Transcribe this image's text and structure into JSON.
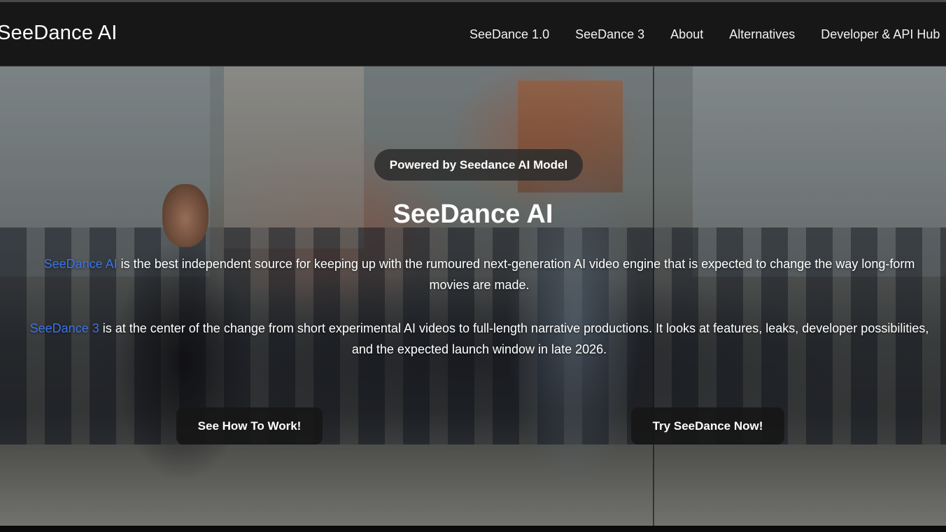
{
  "brand": {
    "name": "SeeDance AI"
  },
  "nav": {
    "items": [
      {
        "label": "SeeDance 1.0"
      },
      {
        "label": "SeeDance 3"
      },
      {
        "label": "About"
      },
      {
        "label": "Alternatives"
      },
      {
        "label": "Developer & API Hub"
      }
    ]
  },
  "hero": {
    "badge": "Powered by Seedance AI Model",
    "title": "SeeDance AI",
    "paragraph1": {
      "link": "SeeDance AI",
      "text": " is the best independent source for keeping up with the rumoured next-generation AI video engine that is expected to change the way long-form movies are made."
    },
    "paragraph2": {
      "link": "SeeDance 3",
      "text": " is at the center of the change from short experimental AI videos to full-length narrative productions. It looks at features, leaks, developer possibilities, and the expected launch window in late 2026."
    },
    "buttons": {
      "primary": "See How To Work!",
      "secondary": "Try SeeDance Now!"
    }
  },
  "colors": {
    "nav_background": "#171717",
    "link_accent": "#3c74e6",
    "button_background": "#161616"
  }
}
